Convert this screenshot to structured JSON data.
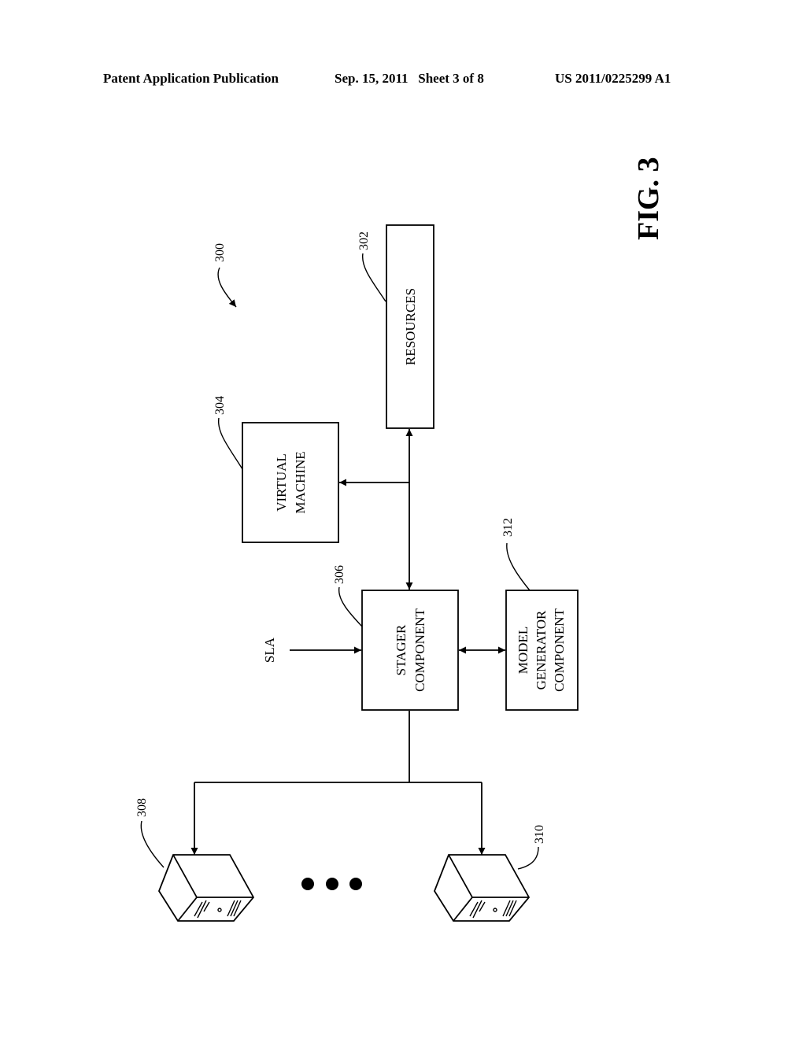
{
  "header": {
    "left": "Patent Application Publication",
    "middle": "Sep. 15, 2011   Sheet 3 of 8",
    "right": "US 2011/0225299 A1"
  },
  "figure": {
    "title": "FIG. 3",
    "system_ref": "300",
    "blocks": {
      "resources": {
        "ref": "302",
        "label": "RESOURCES"
      },
      "virtual_machine": {
        "ref": "304",
        "lines": [
          "VIRTUAL",
          "MACHINE"
        ]
      },
      "stager": {
        "ref": "306",
        "lines": [
          "STAGER",
          "COMPONENT"
        ]
      },
      "model_generator": {
        "ref": "312",
        "lines": [
          "MODEL",
          "GENERATOR",
          "COMPONENT"
        ]
      }
    },
    "input_label": "SLA",
    "servers": [
      {
        "ref": "308",
        "icon": "server-icon"
      },
      {
        "ref": "310",
        "icon": "server-icon"
      }
    ],
    "ellipsis": "more-servers-ellipsis"
  }
}
